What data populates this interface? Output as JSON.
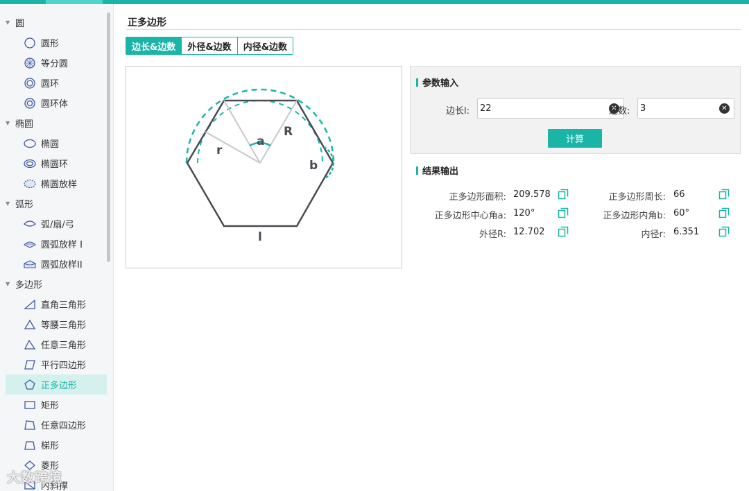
{
  "sidebar": {
    "groups": {
      "circle": "圆",
      "ellipse": "椭圆",
      "arc": "弧形",
      "polygon": "多边形"
    },
    "items": {
      "circle_shape": "圆形",
      "equal_circle": "等分圆",
      "ring": "圆环",
      "ring_body": "圆环体",
      "ellipse_shape": "椭圆",
      "ellipse_ring": "椭圆环",
      "ellipse_layout": "椭圆放样",
      "arc_fan_bow": "弧/扇/弓",
      "arc_layout_1": "圆弧放样 I",
      "arc_layout_2": "圆弧放样II",
      "right_triangle": "直角三角形",
      "isosceles_triangle": "等腰三角形",
      "any_triangle": "任意三角形",
      "parallelogram": "平行四边形",
      "regular_polygon": "正多边形",
      "rectangle": "矩形",
      "any_quadrilateral": "任意四边形",
      "trapezoid": "梯形",
      "rhombus": "菱形",
      "inner_slope": "内斜撑"
    },
    "watermark": "大数跨境"
  },
  "main": {
    "title": "正多边形",
    "tabs": [
      "边长&边数",
      "外径&边数",
      "内径&边数"
    ],
    "active_tab": 0,
    "diagram": {
      "labels": {
        "a": "a",
        "R": "R",
        "r": "r",
        "b": "b",
        "l": "l"
      }
    },
    "input": {
      "title": "参数输入",
      "side_label": "边长l:",
      "side_value": "22",
      "count_label": "边数:",
      "count_value": "3",
      "calc_button": "计算"
    },
    "output": {
      "title": "结果输出",
      "area_label": "正多边形面积:",
      "area_value": "209.578",
      "perimeter_label": "正多边形周长:",
      "perimeter_value": "66",
      "center_angle_label": "正多边形中心角a:",
      "center_angle_value": "120°",
      "inner_angle_label": "正多边形内角b:",
      "inner_angle_value": "60°",
      "outer_radius_label": "外径R:",
      "outer_radius_value": "12.702",
      "inner_radius_label": "内径r:",
      "inner_radius_value": "6.351"
    }
  },
  "colors": {
    "accent": "#1ab5a6",
    "active_bg": "#d5f1ee",
    "icon": "#3d57a0"
  }
}
